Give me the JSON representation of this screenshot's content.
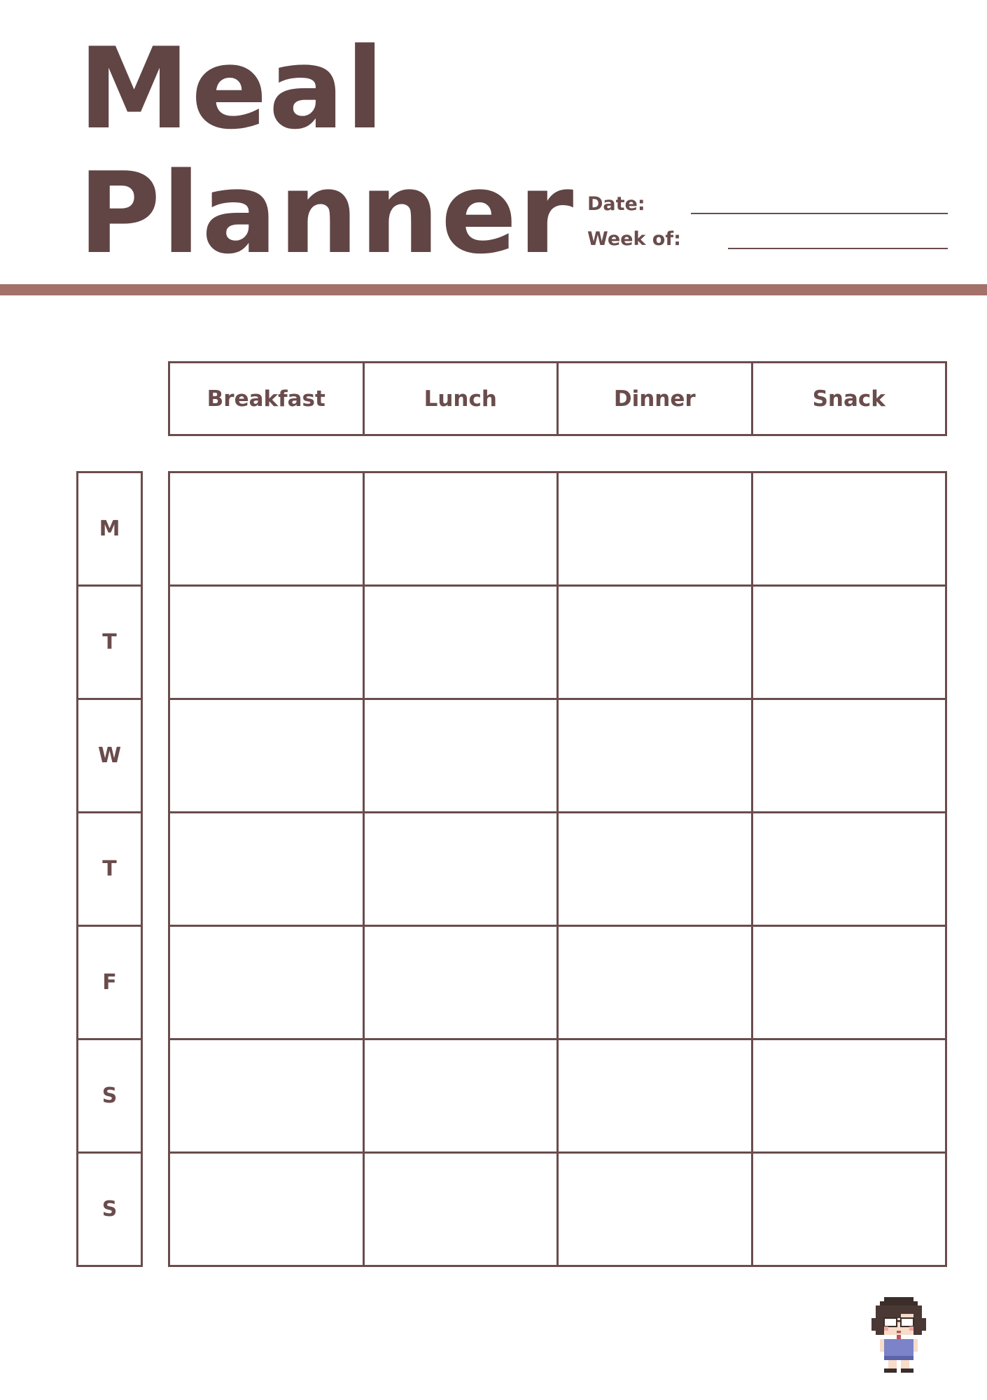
{
  "header": {
    "title_line1": "Meal",
    "title_line2": "Planner",
    "date_label": "Date:",
    "week_label": "Week of:"
  },
  "meals": [
    "Breakfast",
    "Lunch",
    "Dinner",
    "Snack"
  ],
  "days": [
    "M",
    "T",
    "W",
    "T",
    "F",
    "S",
    "S"
  ],
  "colors": {
    "text": "#6a4c4c",
    "title": "#614444",
    "accent_bar": "#a3716a"
  },
  "decorations": {
    "mascot": "pixel-girl-with-glasses-icon"
  }
}
